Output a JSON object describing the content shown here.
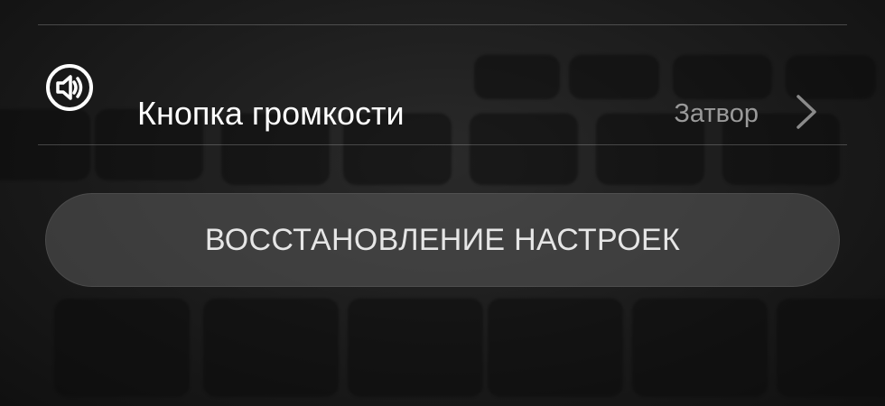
{
  "settings": {
    "volume_key": {
      "title": "Кнопка громкости",
      "value": "Затвор",
      "icon": "speaker-icon"
    }
  },
  "reset": {
    "label": "ВОССТАНОВЛЕНИЕ НАСТРОЕК"
  },
  "colors": {
    "title_text": "#ffffff",
    "value_text": "#9a9a9a",
    "button_bg": "#5a5a5a",
    "divider": "#3a3a3a"
  }
}
